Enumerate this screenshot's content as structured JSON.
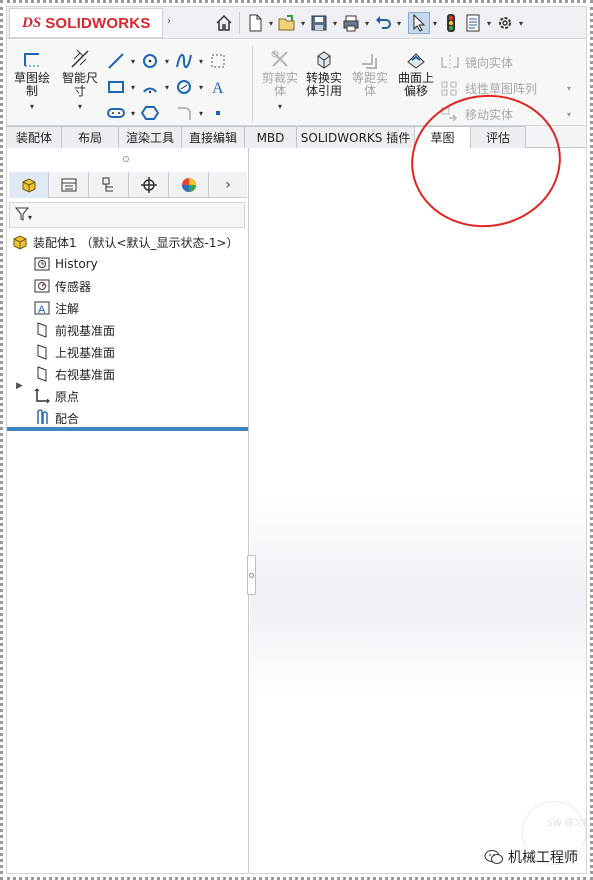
{
  "app": {
    "logo_prefix": "DS",
    "logo_text": "SOLIDWORKS"
  },
  "quick_access": {
    "icons": [
      "home-icon",
      "new-document-icon",
      "open-icon",
      "save-icon",
      "print-icon",
      "undo-icon",
      "select-icon",
      "rebuild-icon",
      "file-properties-icon",
      "options-icon"
    ]
  },
  "command_manager": {
    "sketch": "草图绘制",
    "smart_dimension": "智能尺寸",
    "trim_entities": "剪裁实体",
    "convert_entities": "转换实体引用",
    "offset_entities": "等距实体",
    "offset_on_surface": "曲面上偏移",
    "mirror_entities": "镜向实体",
    "linear_pattern": "线性草图阵列",
    "move_entities": "移动实体"
  },
  "tabs": [
    {
      "label": "装配体",
      "active": false
    },
    {
      "label": "布局",
      "active": false
    },
    {
      "label": "渲染工具",
      "active": false
    },
    {
      "label": "直接编辑",
      "active": false
    },
    {
      "label": "MBD",
      "active": false
    },
    {
      "label": "SOLIDWORKS 插件",
      "active": false
    },
    {
      "label": "草图",
      "active": true
    },
    {
      "label": "评估",
      "active": false
    }
  ],
  "feature_tree": {
    "root": "装配体1 （默认<默认_显示状态-1>）",
    "items": [
      {
        "label": "History",
        "icon": "history-folder-icon"
      },
      {
        "label": "传感器",
        "icon": "sensors-icon"
      },
      {
        "label": "注解",
        "icon": "annotations-icon",
        "expandable": true
      },
      {
        "label": "前视基准面",
        "icon": "plane-icon"
      },
      {
        "label": "上视基准面",
        "icon": "plane-icon"
      },
      {
        "label": "右视基准面",
        "icon": "plane-icon"
      },
      {
        "label": "原点",
        "icon": "origin-icon"
      },
      {
        "label": "配合",
        "icon": "mates-icon"
      }
    ]
  },
  "watermark": {
    "label": "机械工程师",
    "seal_text": "SW 研习社"
  },
  "colors": {
    "brand_red": "#d7262c",
    "selection_blue": "#3e87c4",
    "annotation_red": "#e2251f"
  }
}
